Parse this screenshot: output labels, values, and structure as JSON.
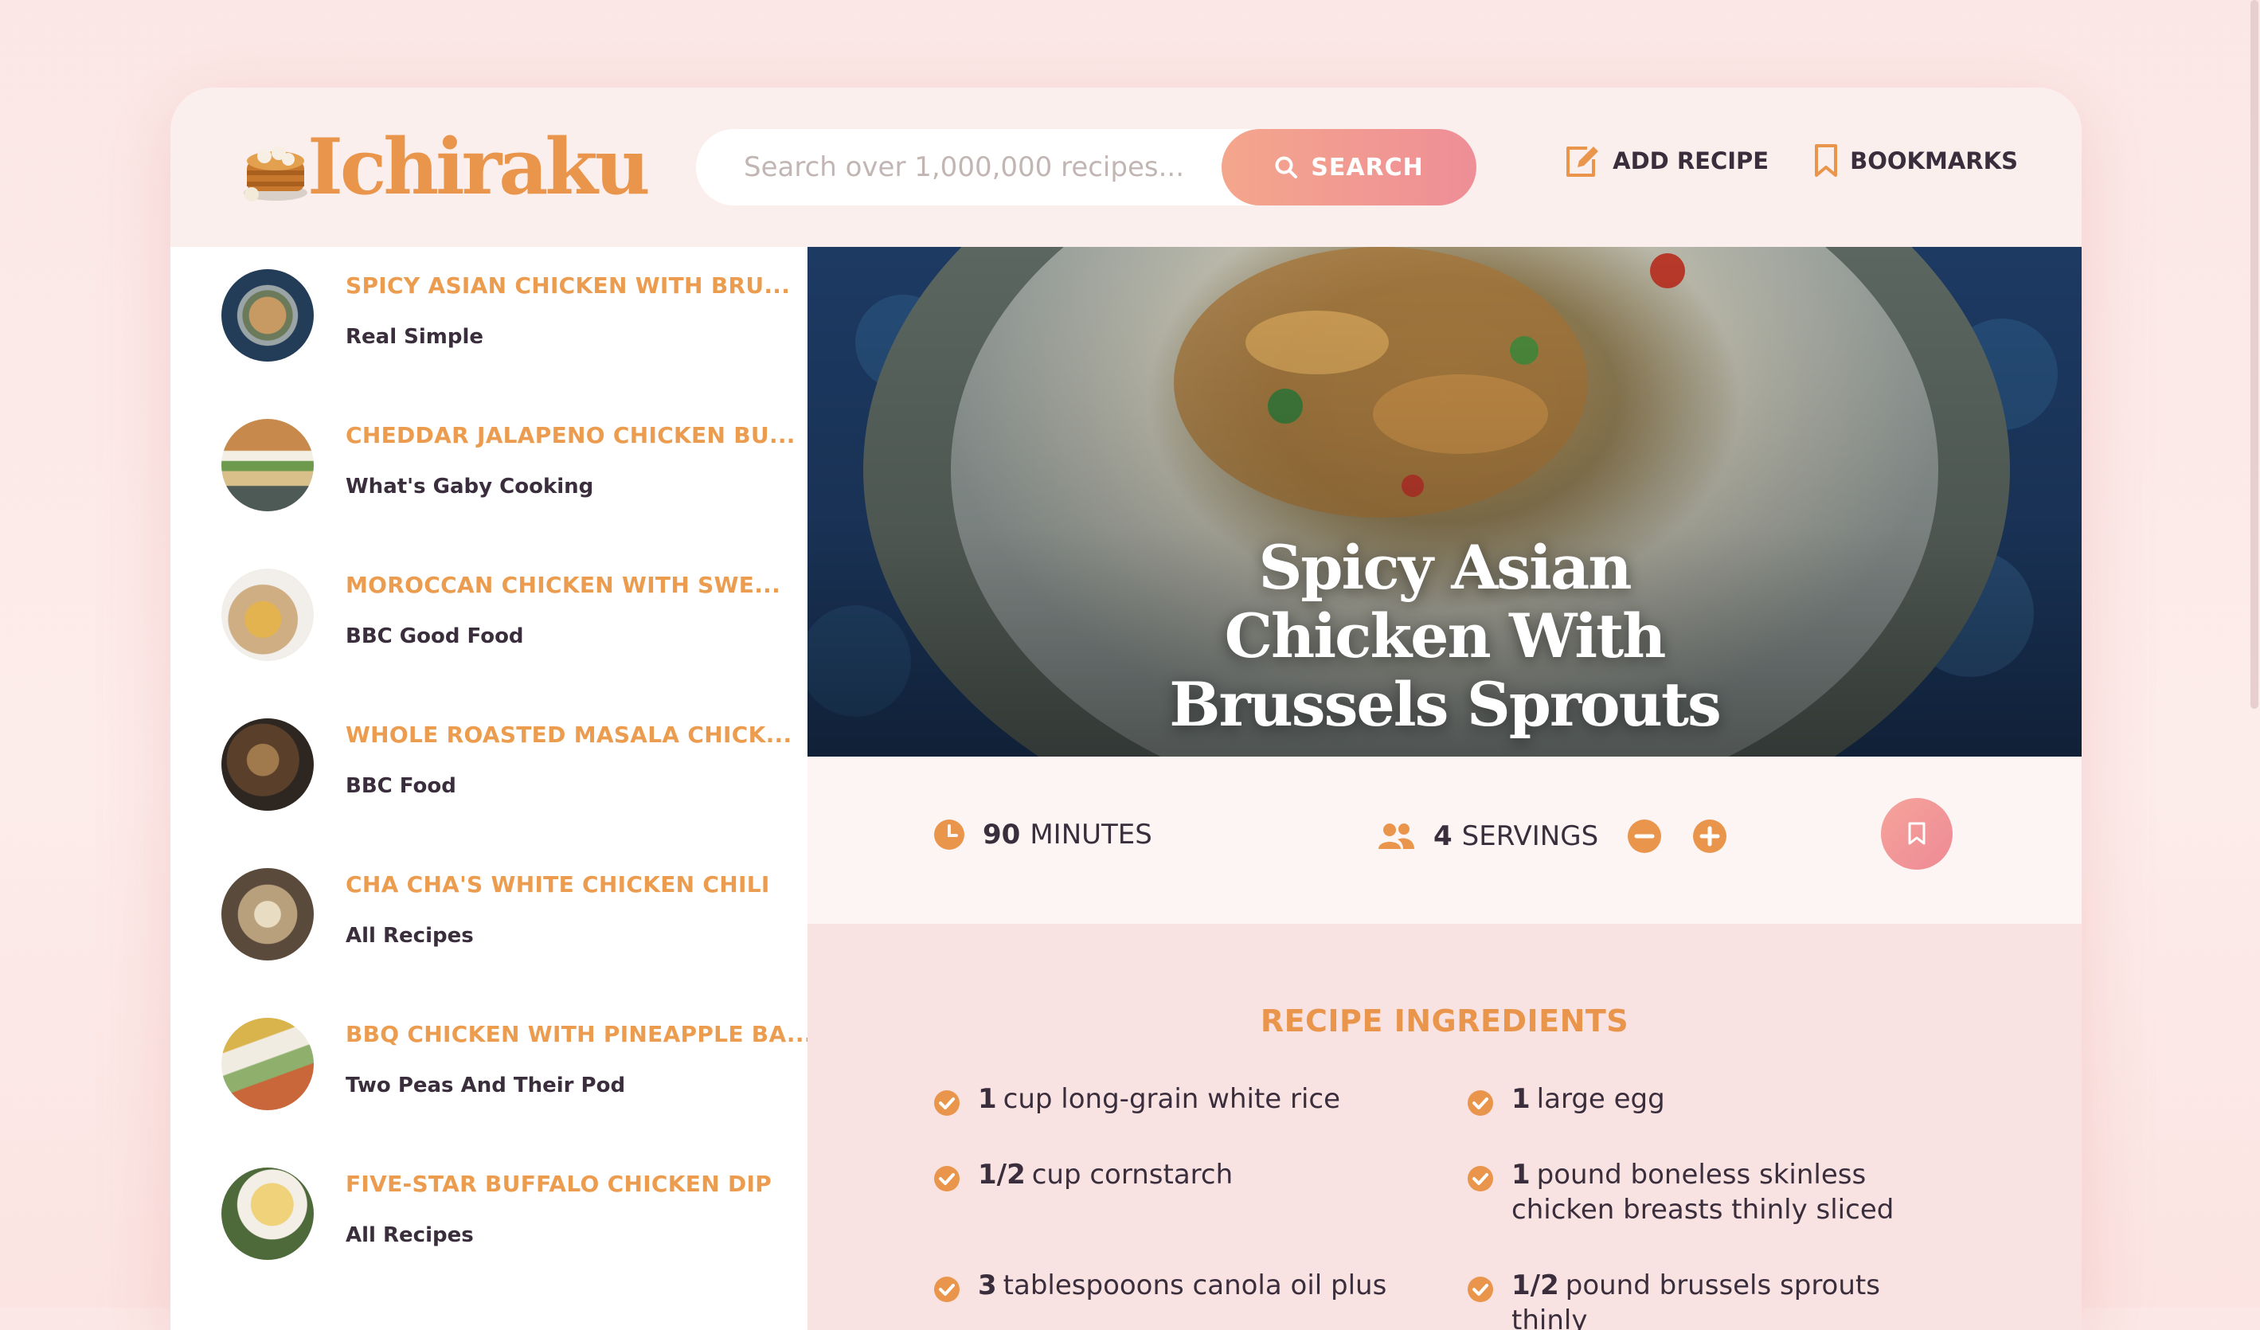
{
  "header": {
    "logo_text": "Ichiraku",
    "search_placeholder": "Search over 1,000,000 recipes...",
    "search_button": "SEARCH",
    "add_recipe": "ADD RECIPE",
    "bookmarks": "BOOKMARKS"
  },
  "results": [
    {
      "title": "SPICY ASIAN CHICKEN WITH BRU...",
      "publisher": "Real Simple"
    },
    {
      "title": "CHEDDAR JALAPENO CHICKEN BU...",
      "publisher": "What's Gaby Cooking"
    },
    {
      "title": "MOROCCAN CHICKEN WITH SWE...",
      "publisher": "BBC Good Food"
    },
    {
      "title": "WHOLE ROASTED MASALA CHICK...",
      "publisher": "BBC Food"
    },
    {
      "title": "CHA CHA'S WHITE CHICKEN CHILI",
      "publisher": "All Recipes"
    },
    {
      "title": "BBQ CHICKEN WITH PINEAPPLE BA...",
      "publisher": "Two Peas And Their Pod"
    },
    {
      "title": "FIVE-STAR BUFFALO CHICKEN DIP",
      "publisher": "All Recipes"
    }
  ],
  "recipe": {
    "title": "Spicy Asian Chicken With Brussels Sprouts",
    "minutes_value": "90",
    "minutes_label": "MINUTES",
    "servings_value": "4",
    "servings_label": "SERVINGS"
  },
  "ingredients": {
    "heading": "RECIPE INGREDIENTS",
    "items": [
      {
        "qty": "1",
        "text": "cup long-grain white rice"
      },
      {
        "qty": "1",
        "text": "large egg"
      },
      {
        "qty": "1/2",
        "text": "cup cornstarch"
      },
      {
        "qty": "1",
        "text": "pound boneless skinless chicken breasts thinly sliced"
      },
      {
        "qty": "3",
        "text": "tablespooons canola oil plus"
      },
      {
        "qty": "1/2",
        "text": "pound brussels sprouts thinly"
      }
    ]
  },
  "colors": {
    "accent": "#e9954c",
    "dark": "#3a2e3d",
    "button_gradient_start": "#f4a68c",
    "button_gradient_end": "#ee8e97"
  },
  "icons": [
    "dim-sum-logo-icon",
    "search-icon",
    "edit-icon",
    "bookmark-icon",
    "clock-icon",
    "users-icon",
    "minus-circle-icon",
    "plus-circle-icon",
    "check-icon"
  ]
}
